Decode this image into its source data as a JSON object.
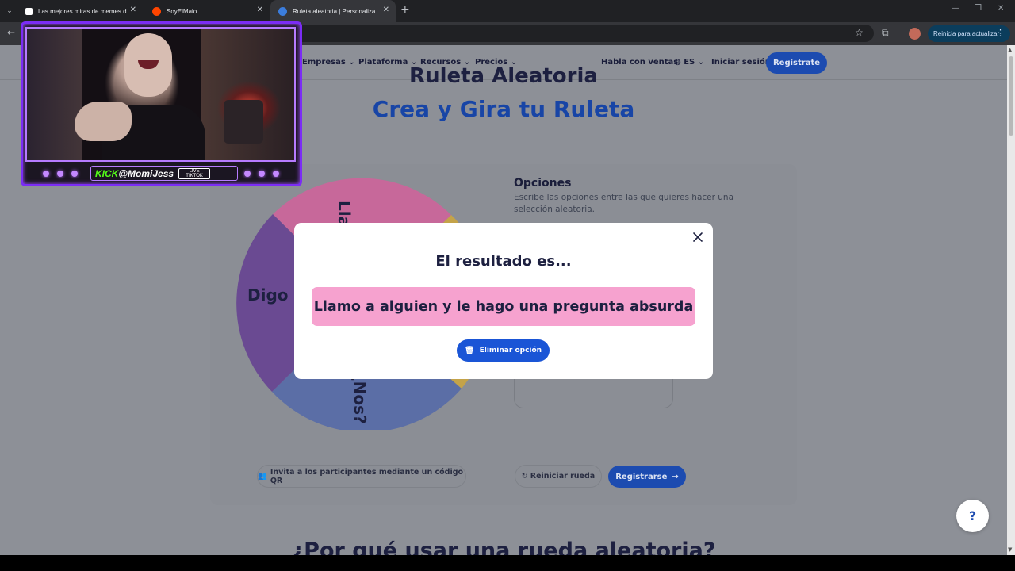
{
  "browser": {
    "tabs": [
      {
        "title": "Las mejores miras de memes d",
        "active": false
      },
      {
        "title": "SoyElMalo",
        "active": false
      },
      {
        "title": "Ruleta aleatoria | Personaliza y",
        "active": true
      }
    ],
    "update_button": "Reinicia para actualizar"
  },
  "nav": {
    "items": [
      "Empresas",
      "Plataforma",
      "Recursos",
      "Precios"
    ],
    "sales": "Habla con ventas",
    "language": "ES",
    "login": "Iniciar sesión",
    "signup": "Regístrate"
  },
  "hero": {
    "title_cut": "Ruleta Aleatoria",
    "title_main": "Crea y Gira tu Ruleta"
  },
  "wheel": {
    "visible_labels": [
      "Llam",
      "Digo",
      "¿Nos?"
    ],
    "colors": [
      "#c7689a",
      "#6a4a92",
      "#5b6ea6",
      "#c4a349"
    ]
  },
  "options": {
    "title": "Opciones",
    "description": "Escribe las opciones entre las que quieres hacer una selección aleatoria."
  },
  "actions": {
    "invite_qr": "Invita a los participantes mediante un código QR",
    "reset_wheel": "Reiniciar rueda",
    "register": "Registrarse"
  },
  "bottom_heading": "¿Por qué usar una rueda aleatoria?",
  "help": "?",
  "modal": {
    "title": "El resultado es...",
    "result": "Llamo a alguien y le hago una pregunta absurda",
    "remove_button": "Eliminar opción",
    "result_color": "#f6a2cf",
    "button_color": "#1a55d6"
  },
  "stream_overlay": {
    "platform": "KICK",
    "handle": "@MomiJess",
    "live_top": "LIVE",
    "live_bottom": "TIKTOK"
  }
}
